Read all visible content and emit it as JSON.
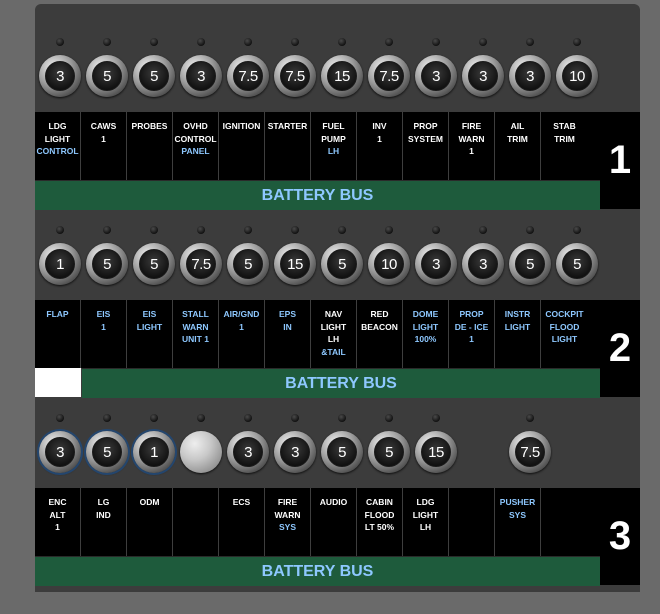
{
  "panels": [
    {
      "number": "1",
      "bus_label": "BATTERY BUS",
      "breakers": [
        "3",
        "5",
        "5",
        "3",
        "7.5",
        "7.5",
        "15",
        "7.5",
        "3",
        "3",
        "3",
        "10"
      ],
      "labels": [
        {
          "lines": [
            "LDG",
            "LIGHT"
          ],
          "blue": [
            "CONTROL"
          ]
        },
        {
          "lines": [
            "CAWS",
            "1"
          ],
          "blue": []
        },
        {
          "lines": [
            "PROBES"
          ],
          "blue": []
        },
        {
          "lines": [
            "OVHD",
            "CONTROL"
          ],
          "blue": [
            "PANEL"
          ]
        },
        {
          "lines": [
            "IGNITION"
          ],
          "blue": []
        },
        {
          "lines": [
            "STARTER"
          ],
          "blue": []
        },
        {
          "lines": [
            "FUEL",
            "PUMP"
          ],
          "blue": [
            "LH"
          ]
        },
        {
          "lines": [
            "INV",
            "1"
          ],
          "blue": []
        },
        {
          "lines": [
            "PROP",
            "SYSTEM"
          ],
          "blue": []
        },
        {
          "lines": [
            "FIRE",
            "WARN",
            "1"
          ],
          "blue": []
        },
        {
          "lines": [
            "AIL",
            "TRIM"
          ],
          "blue": []
        },
        {
          "lines": [
            "STAB",
            "TRIM"
          ],
          "blue": []
        }
      ]
    },
    {
      "number": "2",
      "bus_label": "BATTERY BUS",
      "breakers": [
        "1",
        "5",
        "5",
        "7.5",
        "5",
        "15",
        "5",
        "10",
        "3",
        "3",
        "5",
        "5"
      ],
      "labels": [
        {
          "lines": [],
          "blue": [
            "FLAP"
          ]
        },
        {
          "lines": [],
          "blue": [
            "EIS",
            "1"
          ]
        },
        {
          "lines": [],
          "blue": [
            "EIS",
            "LIGHT"
          ]
        },
        {
          "lines": [],
          "blue": [
            "STALL",
            "WARN",
            "UNIT 1"
          ]
        },
        {
          "lines": [],
          "blue": [
            "AIR/GND",
            "1"
          ]
        },
        {
          "lines": [],
          "blue": [
            "EPS",
            "IN"
          ]
        },
        {
          "lines": [
            "NAV",
            "LIGHT",
            "LH"
          ],
          "blue": [
            "&TAIL"
          ]
        },
        {
          "lines": [
            "RED",
            "BEACON"
          ],
          "blue": []
        },
        {
          "lines": [],
          "blue": [
            "DOME",
            "LIGHT",
            "100%"
          ]
        },
        {
          "lines": [],
          "blue": [
            "PROP",
            "DE - ICE",
            "1"
          ]
        },
        {
          "lines": [],
          "blue": [
            "INSTR",
            "LIGHT"
          ]
        },
        {
          "lines": [],
          "blue": [
            "COCKPIT",
            "FLOOD",
            "LIGHT"
          ]
        }
      ]
    },
    {
      "number": "3",
      "bus_label": "BATTERY BUS",
      "breakers": [
        "3",
        "5",
        "1",
        "",
        "3",
        "3",
        "5",
        "5",
        "15",
        "",
        "7.5",
        ""
      ],
      "labels": [
        {
          "lines": [
            "ENC",
            "ALT",
            "1"
          ],
          "blue": []
        },
        {
          "lines": [
            "LG",
            "IND"
          ],
          "blue": []
        },
        {
          "lines": [
            "ODM"
          ],
          "blue": []
        },
        {
          "lines": [],
          "blue": []
        },
        {
          "lines": [
            "ECS"
          ],
          "blue": []
        },
        {
          "lines": [
            "FIRE",
            "WARN"
          ],
          "blue": [
            "SYS"
          ]
        },
        {
          "lines": [
            "AUDIO"
          ],
          "blue": []
        },
        {
          "lines": [
            "CABIN",
            "FLOOD",
            "LT 50%"
          ],
          "blue": []
        },
        {
          "lines": [
            "LDG",
            "LIGHT",
            "LH"
          ],
          "blue": []
        },
        {
          "lines": [],
          "blue": []
        },
        {
          "lines": [],
          "blue": [
            "PUSHER",
            "SYS"
          ]
        },
        {
          "lines": [],
          "blue": []
        }
      ]
    }
  ]
}
